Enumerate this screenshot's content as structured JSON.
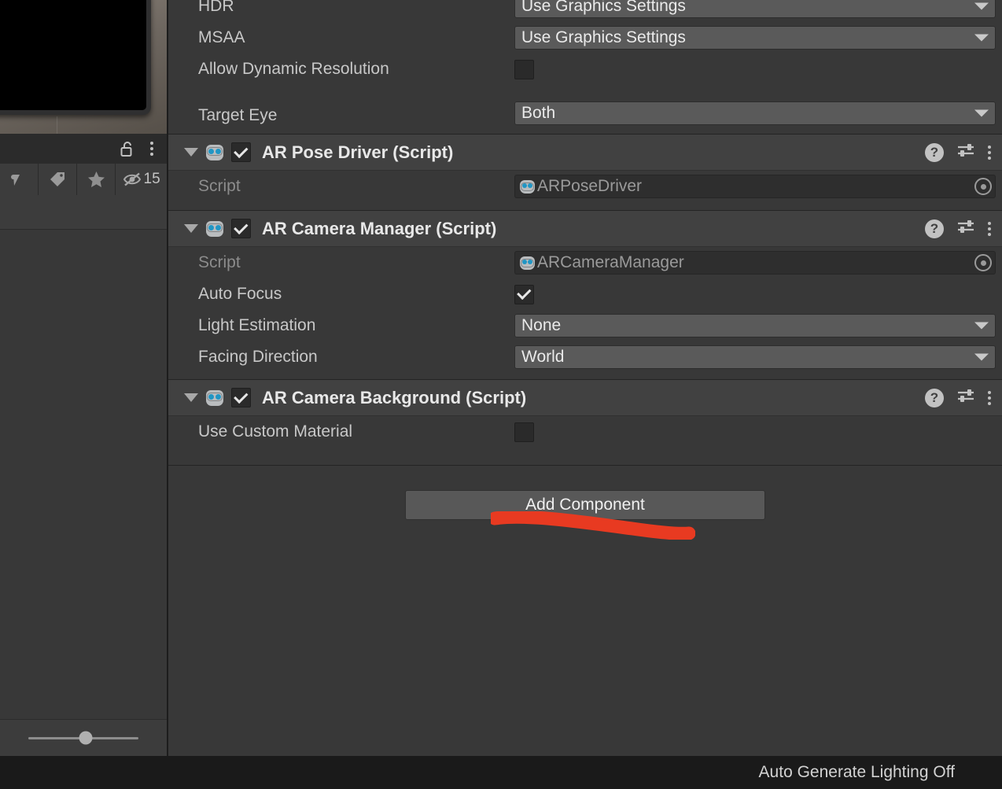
{
  "inspector": {
    "camera_props": [
      {
        "label": "HDR",
        "type": "dropdown",
        "value": "Use Graphics Settings"
      },
      {
        "label": "MSAA",
        "type": "dropdown",
        "value": "Use Graphics Settings"
      },
      {
        "label": "Allow Dynamic Resolution",
        "type": "checkbox",
        "checked": false
      },
      {
        "label": "Target Eye",
        "type": "dropdown",
        "value": "Both"
      }
    ],
    "components": [
      {
        "title": "AR Pose Driver (Script)",
        "enabled": true,
        "icon": "script-icon",
        "actions": [
          "help-icon",
          "preset-icon",
          "more-menu-icon"
        ],
        "rows": [
          {
            "label": "Script",
            "type": "object",
            "value": "ARPoseDriver",
            "readonly": true
          }
        ]
      },
      {
        "title": "AR Camera Manager (Script)",
        "enabled": true,
        "icon": "script-icon",
        "actions": [
          "help-icon",
          "preset-icon",
          "more-menu-icon"
        ],
        "rows": [
          {
            "label": "Script",
            "type": "object",
            "value": "ARCameraManager",
            "readonly": true
          },
          {
            "label": "Auto Focus",
            "type": "checkbox",
            "checked": true
          },
          {
            "label": "Light Estimation",
            "type": "dropdown",
            "value": "None"
          },
          {
            "label": "Facing Direction",
            "type": "dropdown",
            "value": "World"
          }
        ]
      },
      {
        "title": "AR Camera Background (Script)",
        "enabled": true,
        "icon": "script-icon",
        "actions": [
          "help-icon",
          "preset-icon",
          "more-menu-icon"
        ],
        "rows": [
          {
            "label": "Use Custom Material",
            "type": "checkbox",
            "checked": false
          }
        ]
      }
    ],
    "add_component_label": "Add Component",
    "annotation": {
      "type": "freehand-underline",
      "color": "#e83a21",
      "target": "Add Component"
    }
  },
  "left_panel": {
    "game_view": {
      "description": "device-preview-black-screen"
    },
    "header_icons": [
      "lock-open-icon",
      "more-menu-icon"
    ],
    "toolbar_icons": [
      "effects-icon",
      "tag-icon",
      "star-icon",
      "hidden-objects-icon"
    ],
    "hidden_count": "15",
    "zoom_slider": {
      "value": 52
    }
  },
  "status_bar": {
    "message": "Auto Generate Lighting Off"
  },
  "colors": {
    "panel_bg": "#383838",
    "header_bg": "#414141",
    "toolbar_bg": "#3c3c3c",
    "status_bg": "#1a1a1a",
    "dropdown_bg": "#5a5a5a",
    "annotation_red": "#e83a21",
    "text_primary": "#e8e8e8",
    "text_dim": "#8c8c8c",
    "script_eye_blue": "#2196c4"
  }
}
